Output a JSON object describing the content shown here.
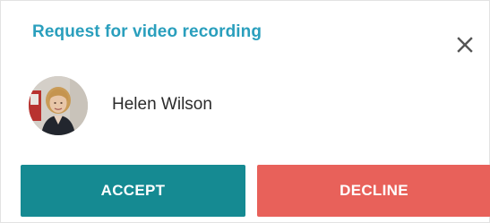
{
  "dialog": {
    "title": "Request for video recording",
    "close_icon": "close-icon"
  },
  "user": {
    "name": "Helen Wilson",
    "avatar": "user-avatar-photo"
  },
  "actions": {
    "accept_label": "ACCEPT",
    "decline_label": "DECLINE"
  },
  "colors": {
    "title": "#2a9fbd",
    "accept": "#158a92",
    "decline": "#e8615a",
    "close_icon": "#555555"
  }
}
